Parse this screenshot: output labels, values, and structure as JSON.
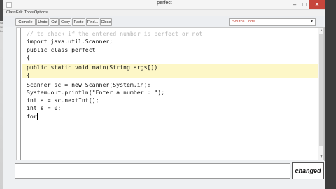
{
  "window": {
    "title": "perfect"
  },
  "side_panel": {
    "items": [
      "Scgr",
      "Sh",
      "hw"
    ]
  },
  "menu": {
    "items": [
      "Class",
      "Edit",
      "Tools",
      "Options"
    ]
  },
  "toolbar": {
    "buttons": [
      "Compile",
      "Undo",
      "Cut",
      "Copy",
      "Paste",
      "Find...",
      "Close"
    ],
    "view_select": "Source Code"
  },
  "editor": {
    "lines": [
      {
        "text": "// to check if the entered number is perfect or not",
        "style": "comment"
      },
      {
        "text": "import java.util.Scanner;",
        "style": "code"
      },
      {
        "text": "public class perfect",
        "style": "code"
      },
      {
        "text": "{",
        "style": "code"
      },
      {
        "text": "public static void main(String args[])",
        "style": "code"
      },
      {
        "text": "{",
        "style": "code"
      },
      {
        "text": "Scanner sc = new Scanner(System.in);",
        "style": "code"
      },
      {
        "text": "System.out.println(\"Enter a number : \");",
        "style": "code"
      },
      {
        "text": "int a = sc.nextInt();",
        "style": "code"
      },
      {
        "text": "int s = 0;",
        "style": "code"
      },
      {
        "text": "for",
        "style": "code"
      }
    ]
  },
  "status": {
    "message": "",
    "changed_label": "changed"
  },
  "colors": {
    "close_button": "#c6463c",
    "highlight": "#fdf7c7",
    "select_text": "#c0392b"
  }
}
